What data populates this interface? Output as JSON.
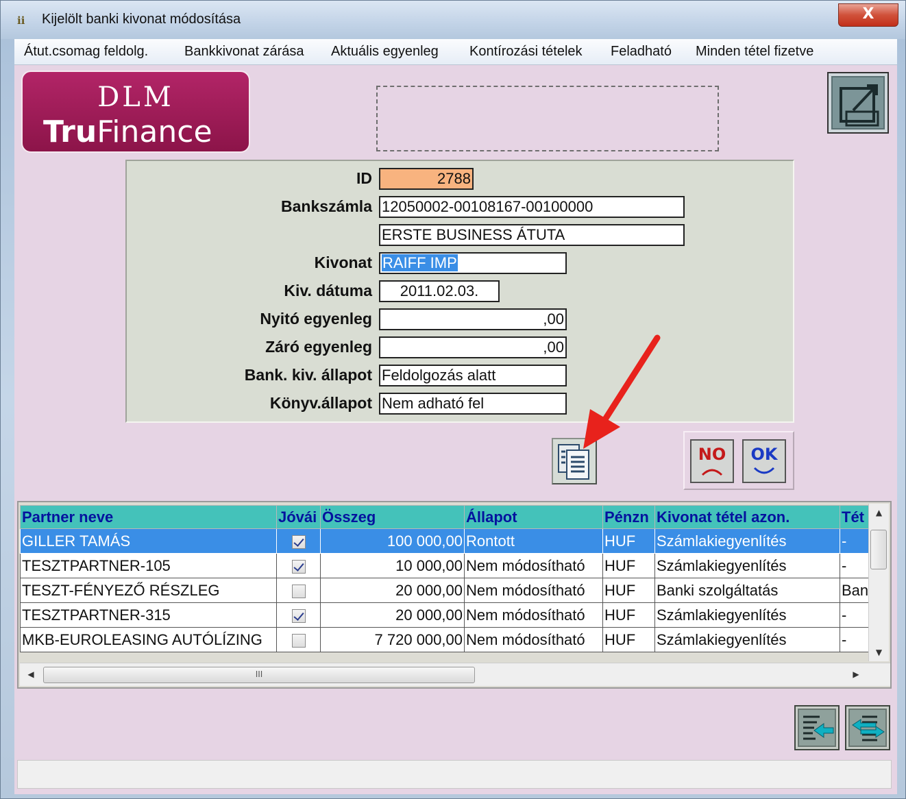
{
  "window": {
    "title": "Kijelölt banki kivonat módosítása",
    "close_label": "X",
    "app_icon_glyph": "ⅱ"
  },
  "menu": [
    "Átut.csomag feldolg.",
    "Bankkivonat zárása",
    "Aktuális egyenleg",
    "Kontírozási tételek",
    "Feladható",
    "Minden tétel fizetve"
  ],
  "logo": {
    "line1": "DLM",
    "line2_bold": "Tru",
    "line2_rest": "Finance"
  },
  "form": {
    "id_label": "ID",
    "id_value": "2788",
    "bankszamla_label": "Bankszámla",
    "bankszamla_value": "12050002-00108167-00100000",
    "bankszamla_name": "ERSTE BUSINESS ÁTUTA",
    "kivonat_label": "Kivonat",
    "kivonat_value": "RAIFF IMP",
    "kiv_datum_label": "Kiv. dátuma",
    "kiv_datum_value": "2011.02.03.",
    "nyito_label": "Nyitó egyenleg",
    "nyito_value": ",00",
    "zaro_label": "Záró egyenleg",
    "zaro_value": ",00",
    "bank_allapot_label": "Bank. kiv. állapot",
    "bank_allapot_value": "Feldolgozás alatt",
    "konyv_allapot_label": "Könyv.állapot",
    "konyv_allapot_value": "Nem adható fel"
  },
  "buttons": {
    "no_label": "NO",
    "ok_label": "OK"
  },
  "grid": {
    "columns": [
      "Partner neve",
      "Jóvái",
      "Összeg",
      "Állapot",
      "Pénzn",
      "Kivonat tétel azon.",
      "Tét"
    ],
    "rows": [
      {
        "partner": "GILLER TAMÁS",
        "checked": true,
        "amount": "100 000,00",
        "state": "Rontott",
        "currency": "HUF",
        "item_id": "Számlakiegyenlítés",
        "extra": "-"
      },
      {
        "partner": "TESZTPARTNER-105",
        "checked": true,
        "amount": "10 000,00",
        "state": "Nem módosítható",
        "currency": "HUF",
        "item_id": "Számlakiegyenlítés",
        "extra": "-"
      },
      {
        "partner": "TESZT-FÉNYEZŐ RÉSZLEG",
        "checked": false,
        "amount": "20 000,00",
        "state": "Nem módosítható",
        "currency": "HUF",
        "item_id": "Banki szolgáltatás",
        "extra": "Ban"
      },
      {
        "partner": "TESZTPARTNER-315",
        "checked": true,
        "amount": "20 000,00",
        "state": "Nem módosítható",
        "currency": "HUF",
        "item_id": "Számlakiegyenlítés",
        "extra": "-"
      },
      {
        "partner": "MKB-EUROLEASING AUTÓLÍZING",
        "checked": false,
        "amount": "7 720 000,00",
        "state": "Nem módosítható",
        "currency": "HUF",
        "item_id": "Számlakiegyenlítés",
        "extra": "-"
      }
    ],
    "hscroll_grip": "III"
  },
  "colors": {
    "client_bg": "#e6d4e4",
    "header_bg": "#44c2ba",
    "header_text": "#05129e",
    "selection": "#3a8ee6",
    "id_field": "#f8b37f",
    "logo_bg": "#9c1a55",
    "arrow": "#e8221c"
  },
  "icons": [
    "app-icon",
    "close-icon",
    "edit-window-icon",
    "copy-document-icon",
    "no-face-icon",
    "ok-face-icon",
    "list-import-icon",
    "list-exchange-icon",
    "red-arrow-annotation"
  ]
}
